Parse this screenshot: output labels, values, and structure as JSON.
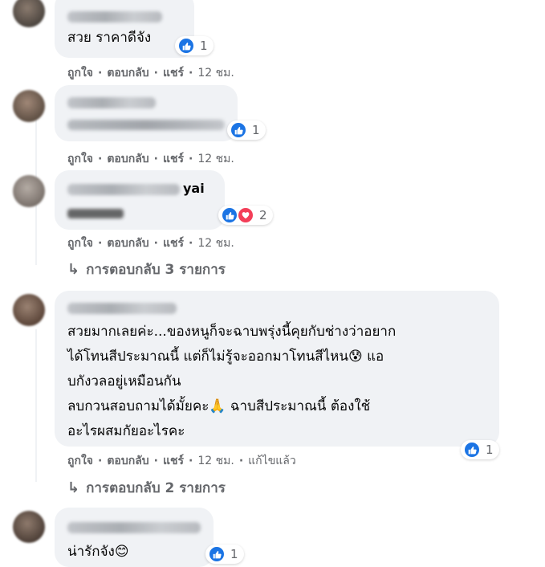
{
  "comments": [
    {
      "text_lines": [
        "สวย ราคาดีจัง"
      ],
      "reaction_count": "1",
      "actions": {
        "like": "ถูกใจ",
        "reply": "ตอบกลับ",
        "share": "แชร์",
        "time": "12 ชม."
      }
    },
    {
      "text_lines": [],
      "reaction_count": "1",
      "actions": {
        "like": "ถูกใจ",
        "reply": "ตอบกลับ",
        "share": "แชร์",
        "time": "12 ชม."
      }
    },
    {
      "name_suffix": "yai",
      "text_lines": [],
      "reaction_count": "2",
      "actions": {
        "like": "ถูกใจ",
        "reply": "ตอบกลับ",
        "share": "แชร์",
        "time": "12 ชม."
      },
      "replies_link": "การตอบกลับ 3 รายการ"
    },
    {
      "text_lines": [
        "สวยมากเลยค่ะ...ของหนูก็จะฉาบพรุ่งนี้คุยกับช่างว่าอยาก",
        "ได้โทนสีประมาณนี้ แต่ก็ไม่รู้จะออกมาโทนสีไหน😰 แอ",
        "บกังวลอยู่เหมือนกัน",
        "ลบกวนสอบถามได้มั้ยคะ🙏 ฉาบสีประมาณนี้ ต้องใช้",
        "อะไรผสมกัยอะไรคะ"
      ],
      "reaction_count": "1",
      "actions": {
        "like": "ถูกใจ",
        "reply": "ตอบกลับ",
        "share": "แชร์",
        "time": "12 ชม.",
        "edited": "แก้ไขแล้ว"
      },
      "replies_link": "การตอบกลับ 2 รายการ"
    },
    {
      "text_lines": [
        "น่ารักจัง😊"
      ],
      "reaction_count": "1"
    }
  ],
  "colors": {
    "bubble": "#f0f2f5",
    "meta": "#65676b",
    "like": "#1b74e4",
    "love": "#f33e58"
  },
  "icons": {
    "like": "thumbs-up-icon",
    "love": "heart-icon",
    "reply_arrow": "reply-arrow-icon"
  }
}
